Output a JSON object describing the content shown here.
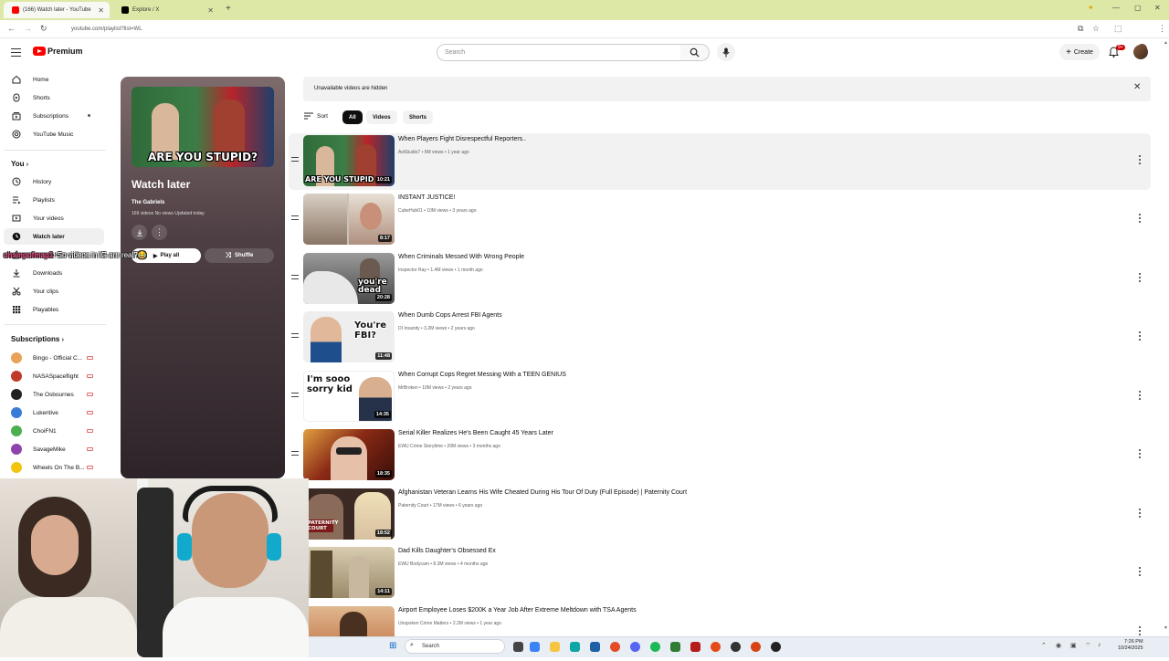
{
  "browser": {
    "tabs": [
      {
        "label": "(166) Watch later - YouTube",
        "active": true
      },
      {
        "label": "Explore / X",
        "active": false
      }
    ],
    "url": "youtube.com/playlist?list=WL"
  },
  "header": {
    "logo_text": "Premium",
    "search_placeholder": "Search",
    "create_label": "Create",
    "notification_count": "9+"
  },
  "sidebar": {
    "main": [
      {
        "label": "Home",
        "icon": "home-icon"
      },
      {
        "label": "Shorts",
        "icon": "shorts-icon"
      },
      {
        "label": "Subscriptions",
        "icon": "subscriptions-icon"
      },
      {
        "label": "YouTube Music",
        "icon": "music-icon"
      }
    ],
    "you_heading": "You",
    "you": [
      {
        "label": "History",
        "icon": "history-icon"
      },
      {
        "label": "Playlists",
        "icon": "playlists-icon"
      },
      {
        "label": "Your videos",
        "icon": "your-videos-icon"
      },
      {
        "label": "Watch later",
        "icon": "clock-icon",
        "active": true
      },
      {
        "label": "Liked videos",
        "icon": "like-icon"
      },
      {
        "label": "Downloads",
        "icon": "download-icon"
      },
      {
        "label": "Your clips",
        "icon": "scissors-icon"
      },
      {
        "label": "Playables",
        "icon": "grid-icon"
      }
    ],
    "subscriptions_heading": "Subscriptions",
    "subscriptions": [
      {
        "label": "Bingo - Official C...",
        "color": "#e8a25a"
      },
      {
        "label": "NASASpaceflight",
        "color": "#c0392b"
      },
      {
        "label": "The Osbournes",
        "color": "#222222"
      },
      {
        "label": "Lukeritive",
        "color": "#3a7bd5"
      },
      {
        "label": "ChoiFN1",
        "color": "#4caf50"
      },
      {
        "label": "SavageMike",
        "color": "#8e44ad"
      },
      {
        "label": "Wheels On The B...",
        "color": "#f1c40f"
      }
    ]
  },
  "playlist": {
    "thumb_caption": "ARE YOU STUPID?",
    "title": "Watch later",
    "owner": "The Gabriels",
    "meta": "169 videos   No views   Updated today",
    "play_all_label": "Play all",
    "shuffle_label": "Shuffle"
  },
  "chat": {
    "user": "champofmap1",
    "message": ": So videos in IG are real?😂"
  },
  "main": {
    "banner_text": "Unavailable videos are hidden",
    "sort_label": "Sort",
    "chips": [
      "All",
      "Videos",
      "Shorts"
    ],
    "videos": [
      {
        "title": "When Players Fight Disrespectful Reporters..",
        "meta": "AstStudio7 • 6M views • 1 year ago",
        "duration": "10:21",
        "overlay": "ARE YOU STUPID",
        "bg": "#2f6b3a",
        "accent": "#b8242a"
      },
      {
        "title": "INSTANT JUSTICE!",
        "meta": "CubeHub01 • 10M views • 3 years ago",
        "duration": "8:17",
        "overlay": "",
        "bg": "#c9c2b8",
        "accent": "#8a7565"
      },
      {
        "title": "When Criminals Messed With Wrong People",
        "meta": "Inspector Ray • 1.4M views • 1 month ago",
        "duration": "20:28",
        "overlay": "you're dead",
        "bg": "#6d6d6d",
        "accent": "#cfcfcf"
      },
      {
        "title": "When Dumb Cops Arrest FBI Agents",
        "meta": "DI Insanity • 3.2M views • 2 years ago",
        "duration": "11:48",
        "overlay": "You're FBI?",
        "bg": "#e8e8e8",
        "accent": "#1e4e8c"
      },
      {
        "title": "When Corrupt Cops Regret Messing With a TEEN GENIUS",
        "meta": "MrBroken • 10M views • 2 years ago",
        "duration": "14:35",
        "overlay": "I'm sooo sorry kid",
        "bg": "#ffffff",
        "accent": "#26324a"
      },
      {
        "title": "Serial Killer Realizes He's Been Caught 45 Years Later",
        "meta": "EWU Crime Storytime • 20M views • 3 months ago",
        "duration": "18:35",
        "overlay": "",
        "bg": "#6a2016",
        "accent": "#e0a040"
      },
      {
        "title": "Afghanistan Veteran Learns His Wife Cheated During His Tour Of Duty (Full Episode) | Paternity Court",
        "meta": "Paternity Court • 17M views • 6 years ago",
        "duration": "18:52",
        "overlay": "PATERNITY COURT",
        "bg": "#3b2a24",
        "accent": "#d8c0a0"
      },
      {
        "title": "Dad Kills Daughter's Obsessed Ex",
        "meta": "EWU Bodycam • 8.3M views • 4 months ago",
        "duration": "14:11",
        "overlay": "",
        "bg": "#9a8a6a",
        "accent": "#5a4a30"
      },
      {
        "title": "Airport Employee Loses $200K a Year Job After Extreme Meltdown with TSA Agents",
        "meta": "Unspoken Crime Matters • 2.2M views • 1 year ago",
        "duration": "",
        "overlay": "",
        "bg": "#c07040",
        "accent": "#4a3020"
      }
    ]
  },
  "taskbar": {
    "search_label": "Search",
    "time": "7:26 PM",
    "date": "10/24/2025"
  }
}
